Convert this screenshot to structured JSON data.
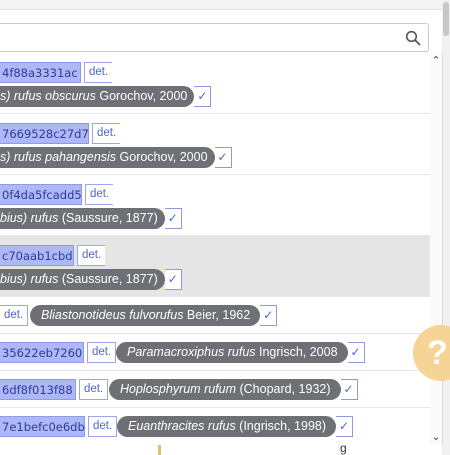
{
  "search": {
    "value": "",
    "placeholder": ""
  },
  "results": [
    {
      "hash": "4f88a3331ac",
      "det_label": "det.",
      "name_prefix": "s) ",
      "name_italic": "rufus obscurus",
      "name_rest": " Gorochov, 2000",
      "check": "✓",
      "selected": false
    },
    {
      "hash": "7669528c27d7",
      "det_label": "det.",
      "name_prefix": "s) ",
      "name_italic": "rufus pahangensis",
      "name_rest": " Gorochov, 2000",
      "check": "✓",
      "selected": false
    },
    {
      "hash": "0f4da5fcadd5",
      "det_label": "det.",
      "name_prefix": "bius) ",
      "name_italic": "rufus",
      "name_rest": " (Saussure, 1877)",
      "check": "✓",
      "selected": false
    },
    {
      "hash": "c70aab1cbd",
      "det_label": "det.",
      "name_prefix": "bius) ",
      "name_italic": "rufus",
      "name_rest": " (Saussure, 1877)",
      "check": "✓",
      "selected": true
    },
    {
      "hash": "",
      "det_label": "det.",
      "name_prefix": "",
      "name_italic": "Bliastonotideus fulvorufus",
      "name_rest": " Beier, 1962",
      "check": "✓",
      "selected": false
    },
    {
      "hash": "35622eb7260",
      "det_label": "det.",
      "name_prefix": "",
      "name_italic": "Paramacroxiphus rufus",
      "name_rest": " Ingrisch, 2008",
      "check": "✓",
      "selected": false
    },
    {
      "hash": "6df8f013f88",
      "det_label": "det.",
      "name_prefix": "",
      "name_italic": "Hoplosphyrum rufum",
      "name_rest": " (Chopard, 1932)",
      "check": "✓",
      "selected": false
    },
    {
      "hash": "7e1befc0e6db",
      "det_label": "det.",
      "name_prefix": "",
      "name_italic": "Euanthracites rufus",
      "name_rest": " (Ingrisch, 1998)",
      "check": "✓",
      "selected": false
    }
  ],
  "scroll": {
    "up": "⌃",
    "down": "⌄"
  },
  "help": {
    "glyph": "?"
  },
  "partial_text": "g"
}
